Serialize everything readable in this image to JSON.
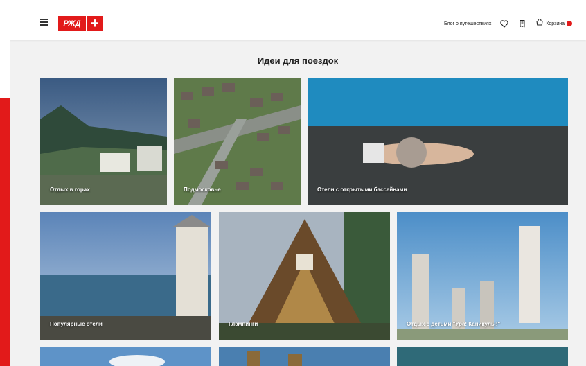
{
  "header": {
    "logo_text": "РЖД",
    "logo_plus": "+",
    "blog_link": "Блог о путешествиях",
    "cart_label": "Корзина"
  },
  "page": {
    "title": "Идеи для поездок"
  },
  "cards": [
    {
      "label": "Отдых в горах"
    },
    {
      "label": "Подмосковье"
    },
    {
      "label": "Отели с открытыми бассейнами"
    },
    {
      "label": "Популярные отели"
    },
    {
      "label": "Глэмпинги"
    },
    {
      "label": "Отдых с детьми \"Ура! Каникулы!\""
    }
  ],
  "colors": {
    "brand": "#e21a1a",
    "background": "#f2f2f2"
  },
  "icons": [
    "menu-icon",
    "heart-icon",
    "bookings-icon",
    "cart-icon"
  ]
}
